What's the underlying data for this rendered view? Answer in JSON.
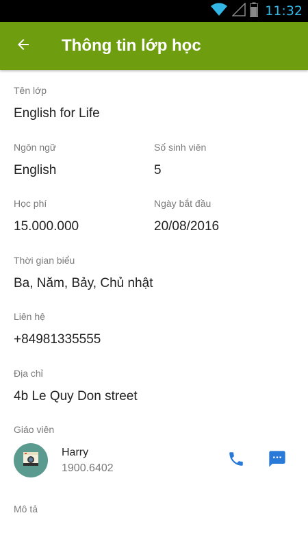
{
  "status_bar": {
    "time": "11:32",
    "time_color": "#33b5e5",
    "icons": [
      "wifi-icon",
      "signal-icon",
      "battery-icon"
    ]
  },
  "app_bar": {
    "title": "Thông tin lớp học",
    "background": "#6e9d0f",
    "back_icon": "arrow-left-icon"
  },
  "class_info": {
    "name_label": "Tên lớp",
    "name": "English for Life",
    "language_label": "Ngôn ngữ",
    "language": "English",
    "students_label": "Số sinh viên",
    "students": "5",
    "fee_label": "Học phí",
    "fee": "15.000.000",
    "start_label": "Ngày bắt đầu",
    "start": "20/08/2016",
    "schedule_label": "Thời gian biểu",
    "schedule": "Ba, Năm, Bảy, Chủ nhật",
    "contact_label": "Liên hệ",
    "contact": "+84981335555",
    "address_label": "Địa chỉ",
    "address": "4b Le Quy Don street",
    "teacher_label": "Giáo viên",
    "description_label": "Mô tả"
  },
  "teacher": {
    "name": "Harry",
    "phone": "1900.6402",
    "avatar_icon": "camera-avatar-icon",
    "call_icon": "phone-icon",
    "message_icon": "message-icon",
    "action_color": "#2979d8"
  }
}
